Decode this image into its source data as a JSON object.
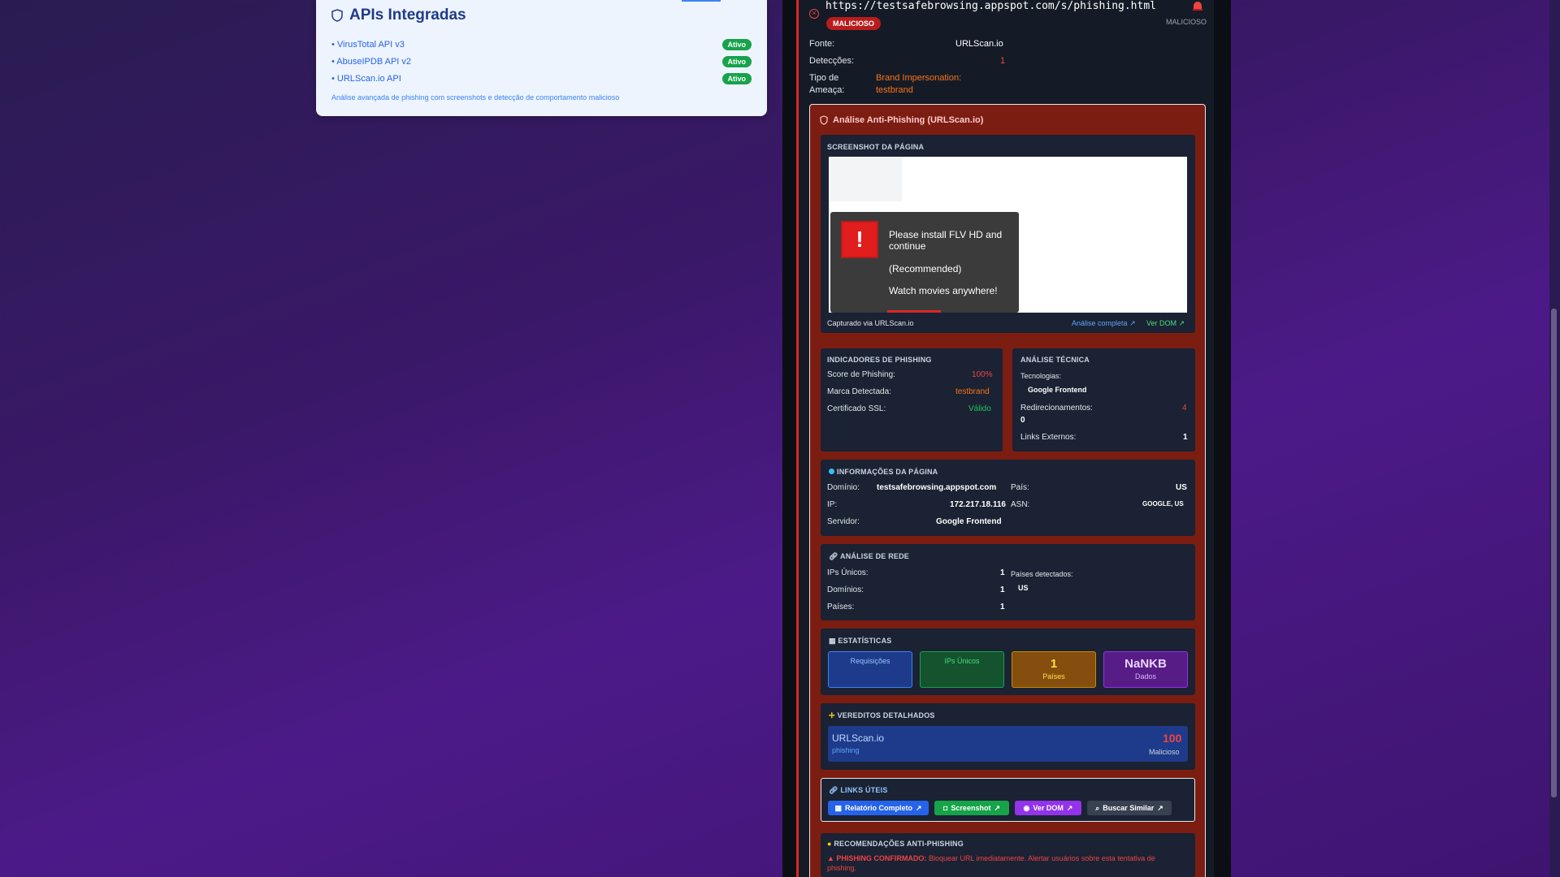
{
  "apis": {
    "title": "APIs Integradas",
    "items": [
      {
        "name": "• VirusTotal API v3",
        "status": "Ativo"
      },
      {
        "name": "• AbuseIPDB API v2",
        "status": "Ativo"
      },
      {
        "name": "• URLScan.io API",
        "status": "Ativo"
      }
    ],
    "footer": "Análise avançada de phishing com screenshots e detecção de comportamento malicioso"
  },
  "result": {
    "url": "https://testsafebrowsing.appspot.com/s/phishing.html",
    "badge": "MALICIOSO",
    "status_right": "MALICIOSO",
    "fonte_label": "Fonte:",
    "fonte_value": "URLScan.io",
    "deteccoes_label": "Detecções:",
    "deteccoes_value": "1",
    "tipo_label_1": "Tipo de",
    "tipo_label_2": "Ameaça:",
    "tipo_value_1": "Brand Impersonation:",
    "tipo_value_2": "testbrand"
  },
  "anti": {
    "title": "Análise Anti-Phishing (URLScan.io)",
    "screenshot_title": "SCREENSHOT DA PÁGINA",
    "popup_lines": [
      "Please install FLV HD and",
      "continue",
      "(Recommended)",
      "Watch movies anywhere!"
    ],
    "captured": "Capturado via URLScan.io",
    "full_analysis": "Análise completa",
    "see_dom": "Ver DOM"
  },
  "indicators": {
    "title": "INDICADORES DE PHISHING",
    "rows": [
      {
        "label": "Score de Phishing:",
        "value": "100%"
      },
      {
        "label": "Marca Detectada:",
        "value": "testbrand"
      },
      {
        "label": "Certificado SSL:",
        "value": "Válido"
      }
    ]
  },
  "technical": {
    "title": "ANÁLISE TÉCNICA",
    "tech_label": "Tecnologias:",
    "tech_value": "Google Frontend",
    "redirect_label": "Redirecionamentos:",
    "redirect_value": "4",
    "redirect_extra": "0",
    "links_label": "Links Externos:",
    "links_value": "1"
  },
  "page_info": {
    "title": "INFORMAÇÕES DA PÁGINA",
    "domain_label": "Domínio:",
    "domain_value": "testsafebrowsing.appspot.com",
    "ip_label": "IP:",
    "ip_value": "172.217.18.116",
    "server_label": "Servidor:",
    "server_value": "Google Frontend",
    "country_label": "País:",
    "country_value": "US",
    "asn_label": "ASN:",
    "asn_value": "GOOGLE, US"
  },
  "network": {
    "title": "ANÁLISE DE REDE",
    "unique_ips_label": "IPs Únicos:",
    "unique_ips_value": "1",
    "domains_label": "Domínios:",
    "domains_value": "1",
    "countries_label": "Países:",
    "countries_value": "1",
    "detected_label": "Países detectados:",
    "detected_value": "US"
  },
  "stats": {
    "title": "ESTATÍSTICAS",
    "cards": [
      {
        "value": "",
        "label": "Requisições"
      },
      {
        "value": "",
        "label": "IPs Únicos"
      },
      {
        "value": "1",
        "label": "Países"
      },
      {
        "value": "NaNKB",
        "label": "Dados"
      }
    ]
  },
  "verdicts": {
    "title": "VEREDITOS DETALHADOS",
    "source": "URLScan.io",
    "category": "phishing",
    "score": "100",
    "score_label": "Malicioso"
  },
  "links": {
    "title": "LINKS ÚTEIS",
    "buttons": [
      "Relatório Completo",
      "Screenshot",
      "Ver DOM",
      "Buscar Similar"
    ]
  },
  "recommend": {
    "title": "RECOMENDAÇÕES ANTI-PHISHING",
    "strong": "PHISHING CONFIRMADO:",
    "text": "Bloquear URL imediatamente. Alertar usuários sobre esta tentativa de",
    "text2": "phishing."
  },
  "colors": {
    "accent_red": "#ef4444",
    "orange": "#f97316",
    "green": "#16a34a",
    "blue": "#3b82f6",
    "purple": "#6d28d9"
  }
}
